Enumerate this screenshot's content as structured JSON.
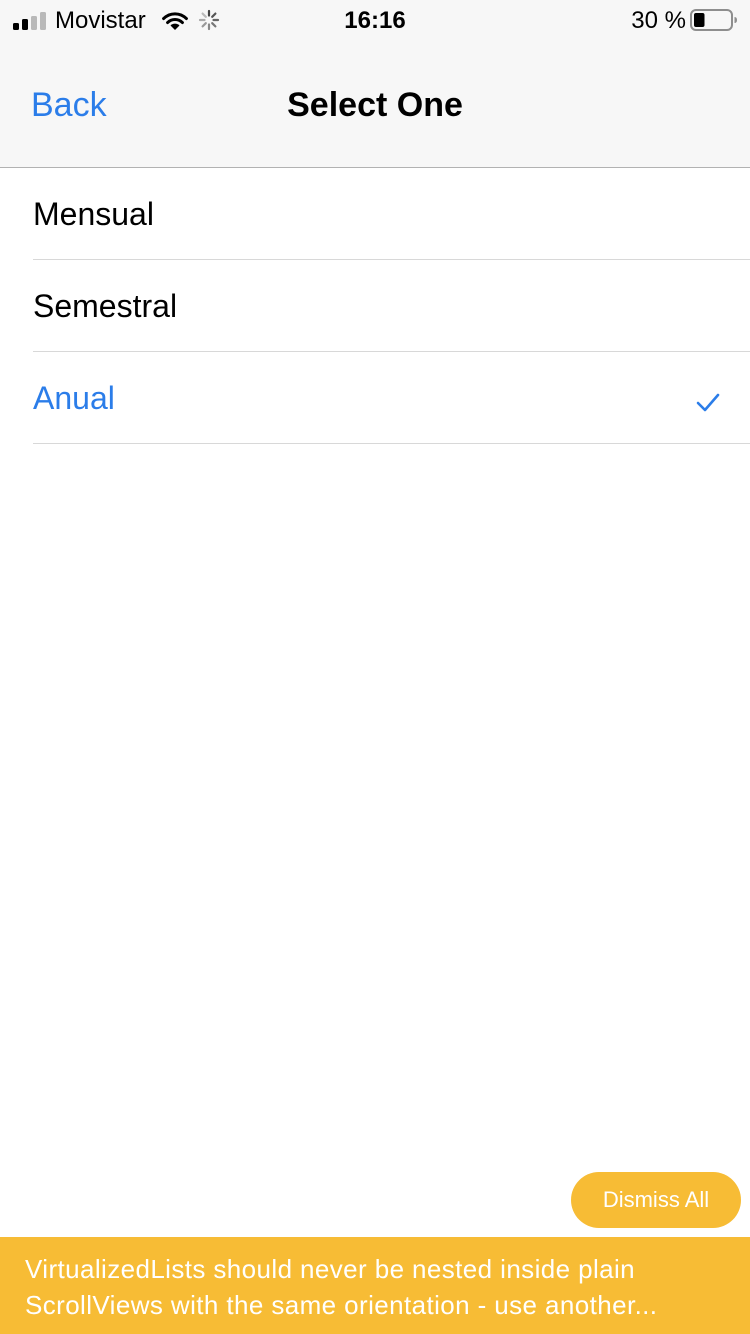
{
  "status_bar": {
    "carrier": "Movistar",
    "time": "16:16",
    "battery_percent": "30 %",
    "battery_level": 0.3,
    "signal_bars": 2,
    "icons": [
      "signal-icon",
      "wifi-icon",
      "activity-spinner-icon",
      "battery-icon"
    ]
  },
  "nav": {
    "back_label": "Back",
    "title": "Select One"
  },
  "options": [
    {
      "label": "Mensual",
      "selected": false
    },
    {
      "label": "Semestral",
      "selected": false
    },
    {
      "label": "Anual",
      "selected": true
    }
  ],
  "warning": {
    "dismiss_label": "Dismiss All",
    "line1": "VirtualizedLists should never be nested inside plain",
    "line2": "ScrollViews with the same orientation - use another..."
  },
  "colors": {
    "accent": "#2b7de9",
    "warning": "#f7bc35",
    "bar_background": "#f7f7f7"
  }
}
